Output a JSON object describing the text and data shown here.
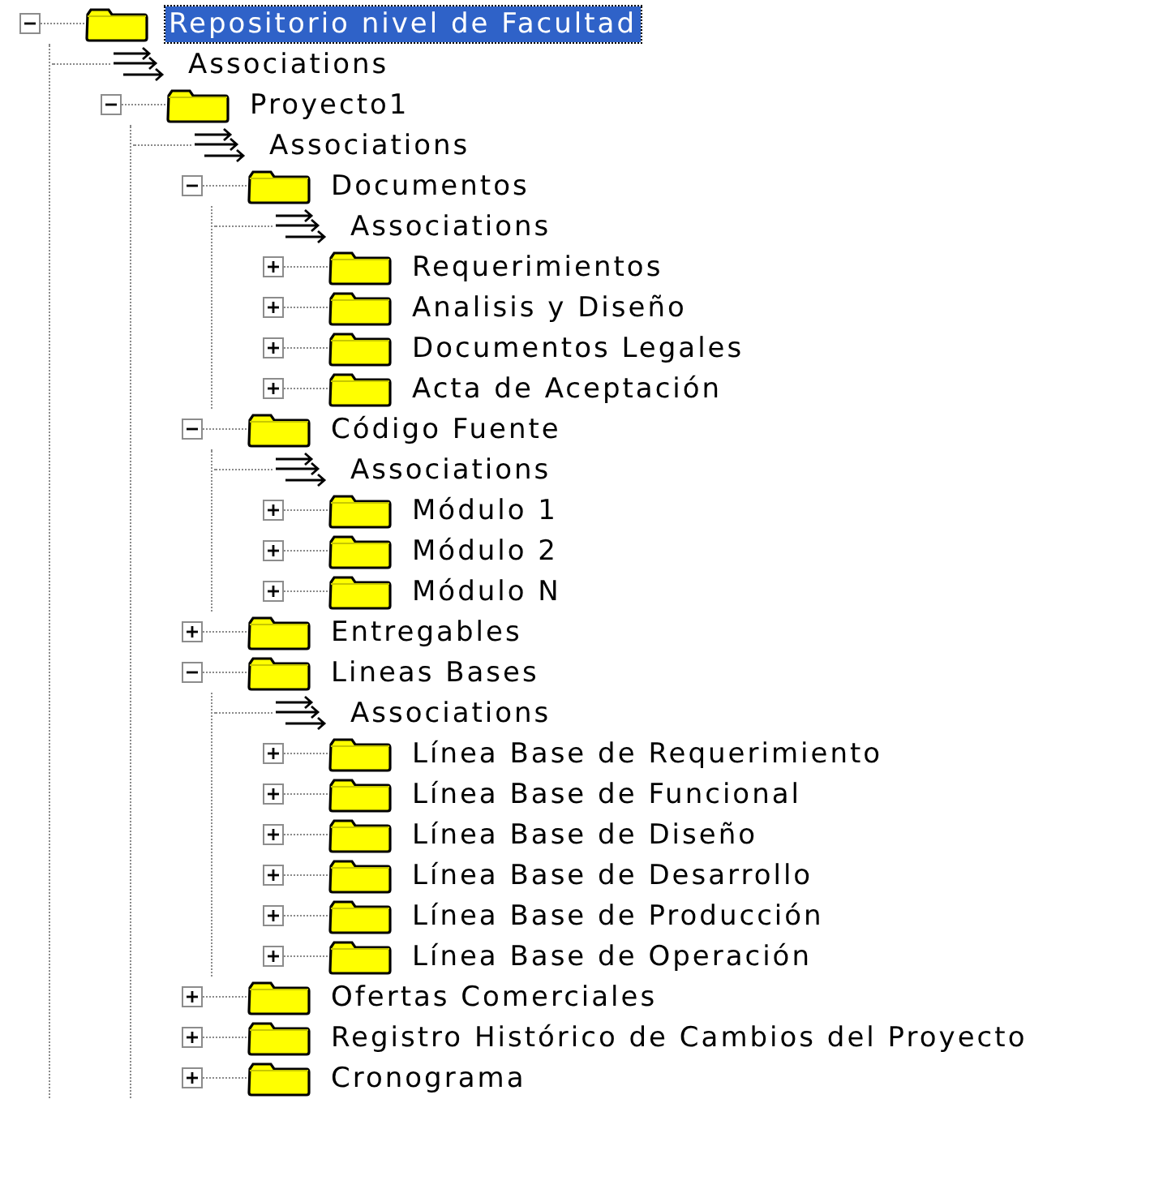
{
  "tree": [
    {
      "kind": "folder",
      "label": "Repositorio nivel de Facultad",
      "expanded": true,
      "selected": true,
      "children": [
        {
          "kind": "associations",
          "label": "Associations",
          "selected": false
        },
        {
          "kind": "folder",
          "label": "Proyecto1",
          "expanded": true,
          "selected": false,
          "children": [
            {
              "kind": "associations",
              "label": "Associations",
              "selected": false
            },
            {
              "kind": "folder",
              "label": "Documentos",
              "expanded": true,
              "selected": false,
              "children": [
                {
                  "kind": "associations",
                  "label": "Associations",
                  "selected": false
                },
                {
                  "kind": "folder",
                  "label": "Requerimientos",
                  "expanded": false,
                  "selected": false
                },
                {
                  "kind": "folder",
                  "label": "Analisis y Diseño",
                  "expanded": false,
                  "selected": false
                },
                {
                  "kind": "folder",
                  "label": "Documentos Legales",
                  "expanded": false,
                  "selected": false
                },
                {
                  "kind": "folder",
                  "label": "Acta de Aceptación",
                  "expanded": false,
                  "selected": false
                }
              ]
            },
            {
              "kind": "folder",
              "label": "Código Fuente",
              "expanded": true,
              "selected": false,
              "children": [
                {
                  "kind": "associations",
                  "label": "Associations",
                  "selected": false
                },
                {
                  "kind": "folder",
                  "label": "Módulo 1",
                  "expanded": false,
                  "selected": false
                },
                {
                  "kind": "folder",
                  "label": "Módulo 2",
                  "expanded": false,
                  "selected": false
                },
                {
                  "kind": "folder",
                  "label": "Módulo N",
                  "expanded": false,
                  "selected": false
                }
              ]
            },
            {
              "kind": "folder",
              "label": "Entregables",
              "expanded": false,
              "selected": false
            },
            {
              "kind": "folder",
              "label": "Lineas Bases",
              "expanded": true,
              "selected": false,
              "children": [
                {
                  "kind": "associations",
                  "label": "Associations",
                  "selected": false
                },
                {
                  "kind": "folder",
                  "label": "Línea Base de Requerimiento",
                  "expanded": false,
                  "selected": false
                },
                {
                  "kind": "folder",
                  "label": "Línea Base de Funcional",
                  "expanded": false,
                  "selected": false
                },
                {
                  "kind": "folder",
                  "label": "Línea Base de Diseño",
                  "expanded": false,
                  "selected": false
                },
                {
                  "kind": "folder",
                  "label": "Línea Base de Desarrollo",
                  "expanded": false,
                  "selected": false
                },
                {
                  "kind": "folder",
                  "label": "Línea Base de Producción",
                  "expanded": false,
                  "selected": false
                },
                {
                  "kind": "folder",
                  "label": "Línea Base de Operación",
                  "expanded": false,
                  "selected": false
                }
              ]
            },
            {
              "kind": "folder",
              "label": "Ofertas Comerciales",
              "expanded": false,
              "selected": false
            },
            {
              "kind": "folder",
              "label": "Registro Histórico de Cambios del Proyecto",
              "expanded": false,
              "selected": false
            },
            {
              "kind": "folder",
              "label": "Cronograma",
              "expanded": false,
              "selected": false
            }
          ]
        }
      ]
    }
  ]
}
